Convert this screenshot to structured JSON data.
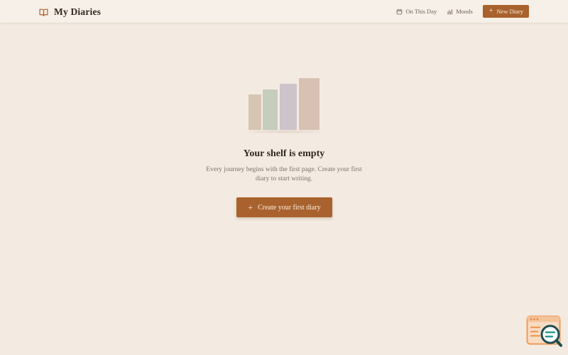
{
  "header": {
    "app_title": "My Diaries",
    "brand_icon": "book-open-icon",
    "nav": [
      {
        "label": "On This Day",
        "icon": "calendar-icon"
      },
      {
        "label": "Moods",
        "icon": "bar-chart-icon"
      }
    ],
    "new_button": {
      "label": "New Diary",
      "icon": "plus-icon"
    }
  },
  "empty_state": {
    "illustration": "bookshelf",
    "title": "Your shelf is empty",
    "description": "Every journey begins with the first page. Create your first diary to start writing.",
    "create_button": {
      "label": "Create your first diary",
      "icon": "plus-icon"
    }
  },
  "colors": {
    "background": "#f3ebe2",
    "accent": "#a9622d",
    "book_1": "#d6c5b1",
    "book_2": "#c5cdbd",
    "book_3": "#cdc3ca",
    "book_4": "#d8c1b3"
  },
  "helper_widget": {
    "icon": "search-doc-icon"
  }
}
